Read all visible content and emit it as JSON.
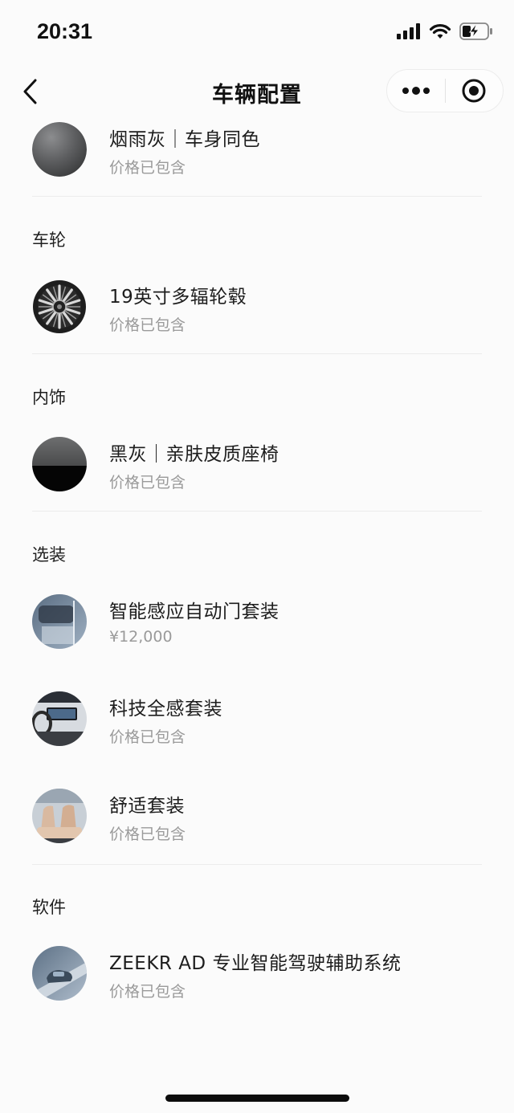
{
  "status_bar": {
    "time": "20:31",
    "icons": [
      "cellular-signal-icon",
      "wifi-icon",
      "battery-charging-icon"
    ]
  },
  "nav": {
    "title": "车辆配置",
    "back_icon": "chevron-left-icon",
    "more_icon": "more-dots-icon",
    "close_icon": "target-circle-icon"
  },
  "sections": {
    "exterior": {
      "items": [
        {
          "title": "烟雨灰｜车身同色",
          "subtitle": "价格已包含",
          "icon": "paint-swatch-gray"
        }
      ]
    },
    "wheels": {
      "heading": "车轮",
      "items": [
        {
          "title": "19英寸多辐轮毂",
          "subtitle": "价格已包含",
          "icon": "wheel-rim"
        }
      ]
    },
    "interior": {
      "heading": "内饰",
      "items": [
        {
          "title": "黑灰｜亲肤皮质座椅",
          "subtitle": "价格已包含",
          "icon": "interior-swatch-black-gray"
        }
      ]
    },
    "options": {
      "heading": "选装",
      "items": [
        {
          "title": "智能感应自动门套装",
          "subtitle": "¥12,000",
          "icon": "door-photo"
        },
        {
          "title": "科技全感套装",
          "subtitle": "价格已包含",
          "icon": "cockpit-photo"
        },
        {
          "title": "舒适套装",
          "subtitle": "价格已包含",
          "icon": "seat-photo"
        }
      ]
    },
    "software": {
      "heading": "软件",
      "items": [
        {
          "title": "ZEEKR AD 专业智能驾驶辅助系统",
          "subtitle": "价格已包含",
          "icon": "car-road-photo"
        }
      ]
    }
  },
  "colors": {
    "background": "#fbfbfb",
    "text_primary": "#1d1d1d",
    "text_secondary": "#9a9a9a",
    "divider": "#ececec"
  }
}
